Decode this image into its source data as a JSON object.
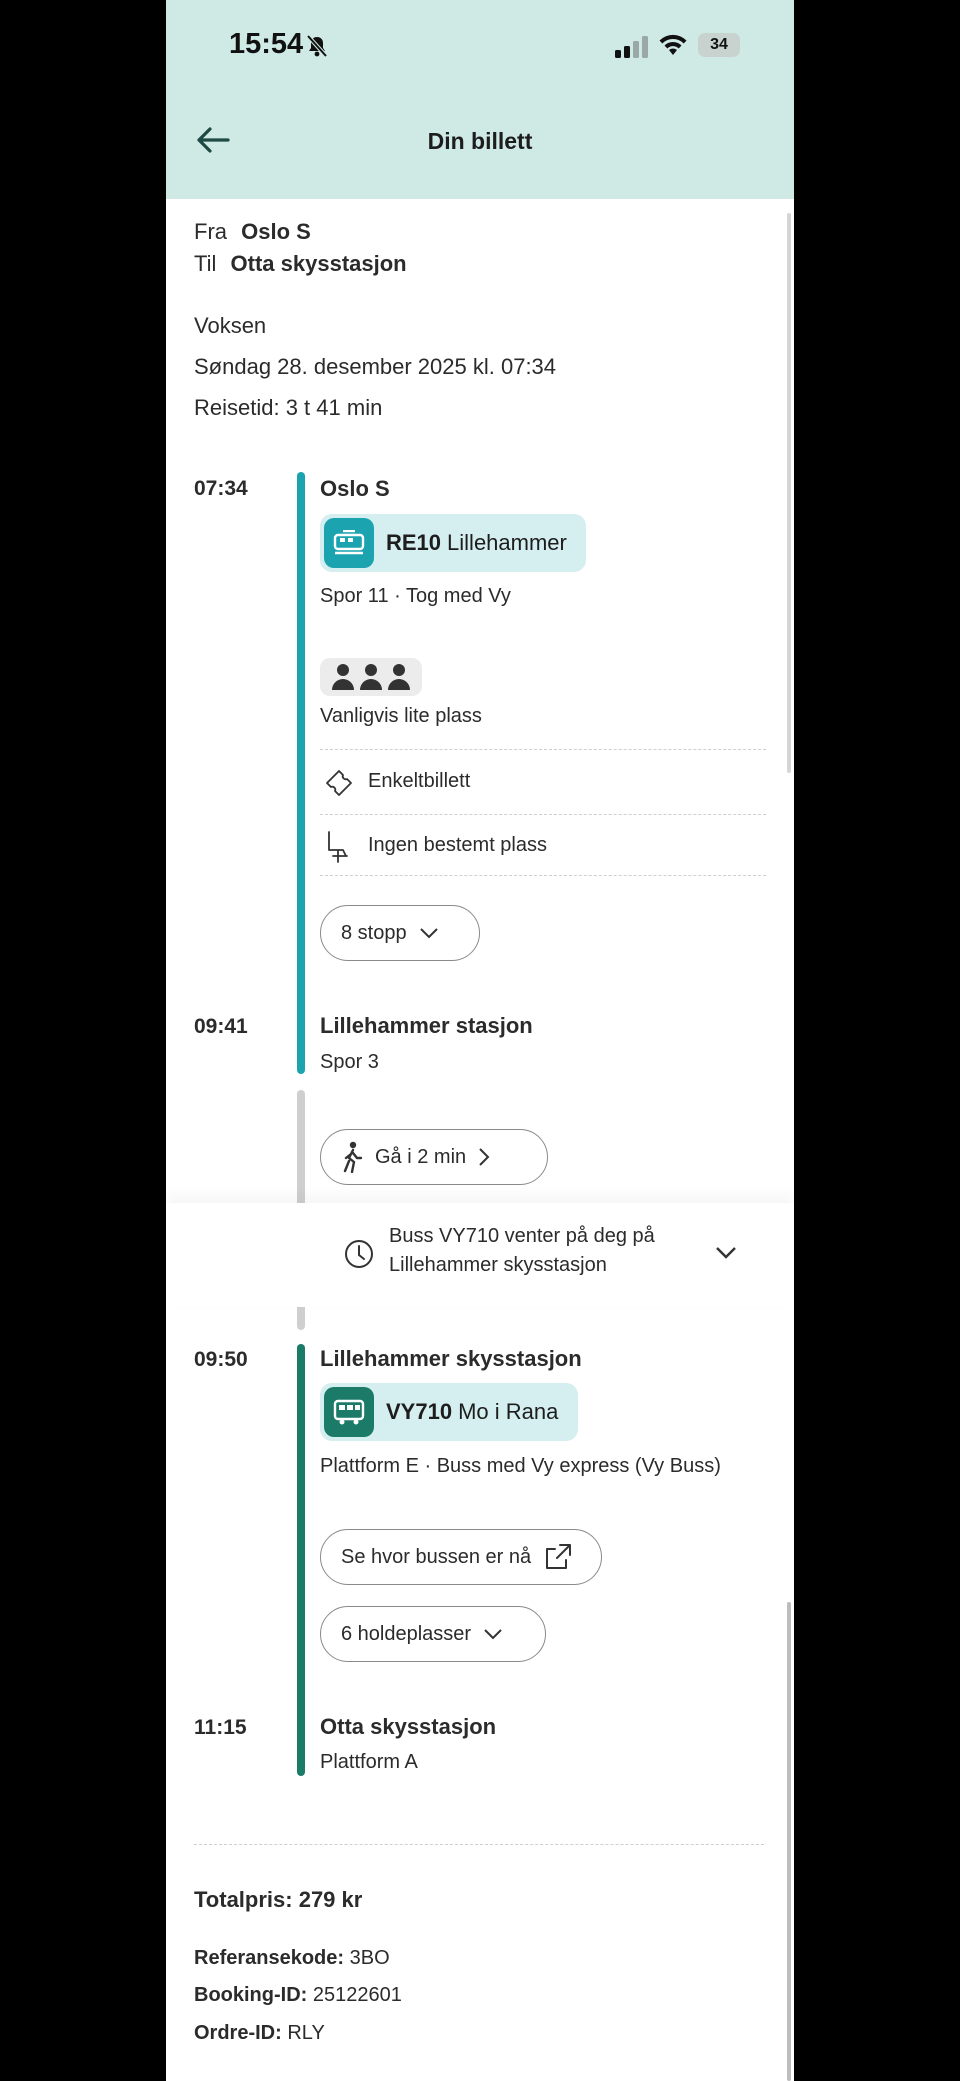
{
  "status_bar": {
    "time": "15:54",
    "battery": "34"
  },
  "header": {
    "title": "Din billett"
  },
  "summary": {
    "from_label": "Fra",
    "from_value": "Oslo S",
    "to_label": "Til",
    "to_value": "Otta skysstasjon",
    "passenger": "Voksen",
    "date": "Søndag 28. desember 2025 kl. 07:34",
    "travel_time": "Reisetid: 3 t 41 min"
  },
  "leg1": {
    "dep_time": "07:34",
    "dep_station": "Oslo S",
    "line_code": "RE10",
    "line_dest": "Lillehammer",
    "platform_info": "Spor 11 · Tog med Vy",
    "crowd_text": "Vanligvis lite plass",
    "ticket_type": "Enkeltbillett",
    "seat_info": "Ingen bestemt plass",
    "stops_button": "8 stopp",
    "arr_time": "09:41",
    "arr_station": "Lillehammer stasjon",
    "arr_platform": "Spor 3"
  },
  "transfer": {
    "walk_button": "Gå i 2 min",
    "wait_line1": "Buss VY710 venter på deg på",
    "wait_line2": "Lillehammer skysstasjon"
  },
  "leg2": {
    "dep_time": "09:50",
    "dep_station": "Lillehammer skysstasjon",
    "line_code": "VY710",
    "line_dest": "Mo i Rana",
    "platform_info": "Plattform E · Buss med Vy express (Vy Buss)",
    "track_button": "Se hvor bussen er nå",
    "stops_button": "6 holdeplasser",
    "arr_time": "11:15",
    "arr_station": "Otta skysstasjon",
    "arr_platform": "Plattform A"
  },
  "footer": {
    "total": "Totalpris: 279 kr",
    "ref_label": "Referansekode:",
    "ref_value": "3BO",
    "booking_label": "Booking-ID:",
    "booking_value": "25122601",
    "order_label": "Ordre-ID:",
    "order_value": "RLY"
  },
  "colors": {
    "header_bg": "#cfe9e4",
    "train": "#1ba4b0",
    "bus": "#1b7a68",
    "walk": "#cfcfcf"
  }
}
